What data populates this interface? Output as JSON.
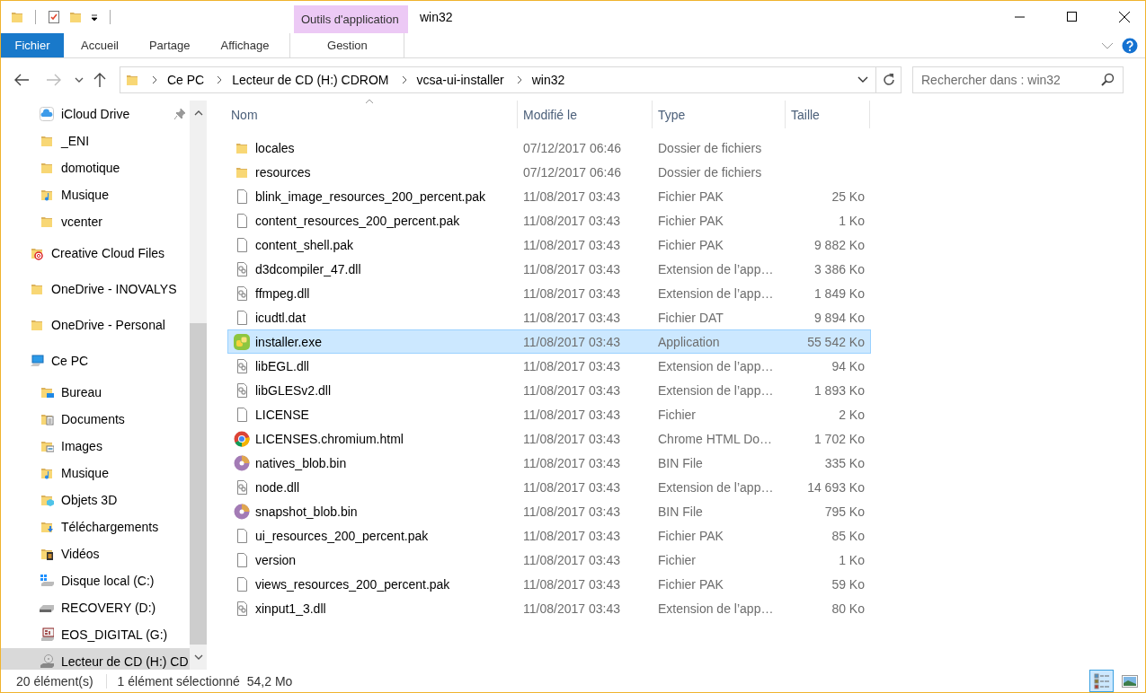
{
  "window": {
    "title": "win32",
    "context_tab_group": "Outils d'application"
  },
  "ribbon_tabs": [
    {
      "label": "Fichier",
      "kind": "file",
      "selected": false,
      "contextual": false
    },
    {
      "label": "Accueil",
      "kind": "tab",
      "selected": false,
      "contextual": false
    },
    {
      "label": "Partage",
      "kind": "tab",
      "selected": false,
      "contextual": false
    },
    {
      "label": "Affichage",
      "kind": "tab",
      "selected": false,
      "contextual": false
    },
    {
      "label": "Gestion",
      "kind": "tab",
      "selected": false,
      "contextual": true
    }
  ],
  "address_bar": {
    "breadcrumbs": [
      "Ce PC",
      "Lecteur de CD (H:) CDROM",
      "vcsa-ui-installer",
      "win32"
    ]
  },
  "search": {
    "placeholder": "Rechercher dans : win32"
  },
  "sidebar": {
    "quick_access": [
      {
        "label": "iCloud Drive",
        "kind": "icloud",
        "pinned": true,
        "selected": false
      },
      {
        "label": "_ENI",
        "kind": "folder",
        "pinned": false,
        "selected": false
      },
      {
        "label": "domotique",
        "kind": "folder",
        "pinned": false,
        "selected": false
      },
      {
        "label": "Musique",
        "kind": "music",
        "pinned": false,
        "selected": false
      },
      {
        "label": "vcenter",
        "kind": "folder",
        "pinned": false,
        "selected": false
      }
    ],
    "places": [
      {
        "label": "Creative Cloud Files",
        "kind": "cc",
        "selected": false
      },
      {
        "label": "OneDrive - INOVALYS",
        "kind": "folder",
        "selected": false
      },
      {
        "label": "OneDrive - Personal",
        "kind": "folder",
        "selected": false
      },
      {
        "label": "Ce PC",
        "kind": "pc",
        "selected": false,
        "children": [
          {
            "label": "Bureau",
            "kind": "desktop",
            "selected": false
          },
          {
            "label": "Documents",
            "kind": "documents",
            "selected": false
          },
          {
            "label": "Images",
            "kind": "images",
            "selected": false
          },
          {
            "label": "Musique",
            "kind": "music",
            "selected": false
          },
          {
            "label": "Objets 3D",
            "kind": "objects3d",
            "selected": false
          },
          {
            "label": "Téléchargements",
            "kind": "downloads",
            "selected": false
          },
          {
            "label": "Vidéos",
            "kind": "videos",
            "selected": false
          },
          {
            "label": "Disque local (C:)",
            "kind": "windisk",
            "selected": false
          },
          {
            "label": "RECOVERY (D:)",
            "kind": "disk",
            "selected": false
          },
          {
            "label": "EOS_DIGITAL (G:)",
            "kind": "sd",
            "selected": false
          },
          {
            "label": "Lecteur de CD (H:) CD",
            "kind": "cd",
            "selected": true
          }
        ]
      }
    ]
  },
  "table": {
    "columns": [
      "Nom",
      "Modifié le",
      "Type",
      "Taille"
    ],
    "rows": [
      {
        "name": "locales",
        "kind": "folder",
        "modified": "07/12/2017 06:46",
        "type": "Dossier de fichiers",
        "selected": false
      },
      {
        "name": "resources",
        "kind": "folder",
        "modified": "07/12/2017 06:46",
        "type": "Dossier de fichiers",
        "selected": false
      },
      {
        "name": "blink_image_resources_200_percent.pak",
        "kind": "file",
        "modified": "11/08/2017 03:43",
        "type": "Fichier PAK",
        "size": "25 Ko",
        "selected": false
      },
      {
        "name": "content_resources_200_percent.pak",
        "kind": "file",
        "modified": "11/08/2017 03:43",
        "type": "Fichier PAK",
        "size": "1 Ko",
        "selected": false
      },
      {
        "name": "content_shell.pak",
        "kind": "file",
        "modified": "11/08/2017 03:43",
        "type": "Fichier PAK",
        "size": "9 882 Ko",
        "selected": false
      },
      {
        "name": "d3dcompiler_47.dll",
        "kind": "dll",
        "modified": "11/08/2017 03:43",
        "type": "Extension de l’app…",
        "size": "3 386 Ko",
        "selected": false
      },
      {
        "name": "ffmpeg.dll",
        "kind": "dll",
        "modified": "11/08/2017 03:43",
        "type": "Extension de l’app…",
        "size": "1 849 Ko",
        "selected": false
      },
      {
        "name": "icudtl.dat",
        "kind": "file",
        "modified": "11/08/2017 03:43",
        "type": "Fichier DAT",
        "size": "9 894 Ko",
        "selected": false
      },
      {
        "name": "installer.exe",
        "kind": "exe",
        "modified": "11/08/2017 03:43",
        "type": "Application",
        "size": "55 542 Ko",
        "selected": true
      },
      {
        "name": "libEGL.dll",
        "kind": "dll",
        "modified": "11/08/2017 03:43",
        "type": "Extension de l’app…",
        "size": "94 Ko",
        "selected": false
      },
      {
        "name": "libGLESv2.dll",
        "kind": "dll",
        "modified": "11/08/2017 03:43",
        "type": "Extension de l’app…",
        "size": "1 893 Ko",
        "selected": false
      },
      {
        "name": "LICENSE",
        "kind": "file",
        "modified": "11/08/2017 03:43",
        "type": "Fichier",
        "size": "2 Ko",
        "selected": false
      },
      {
        "name": "LICENSES.chromium.html",
        "kind": "chrome",
        "modified": "11/08/2017 03:43",
        "type": "Chrome HTML Do…",
        "size": "1 702 Ko",
        "selected": false
      },
      {
        "name": "natives_blob.bin",
        "kind": "bin",
        "modified": "11/08/2017 03:43",
        "type": "BIN File",
        "size": "335 Ko",
        "selected": false
      },
      {
        "name": "node.dll",
        "kind": "dll",
        "modified": "11/08/2017 03:43",
        "type": "Extension de l’app…",
        "size": "14 693 Ko",
        "selected": false
      },
      {
        "name": "snapshot_blob.bin",
        "kind": "bin",
        "modified": "11/08/2017 03:43",
        "type": "BIN File",
        "size": "795 Ko",
        "selected": false
      },
      {
        "name": "ui_resources_200_percent.pak",
        "kind": "file",
        "modified": "11/08/2017 03:43",
        "type": "Fichier PAK",
        "size": "85 Ko",
        "selected": false
      },
      {
        "name": "version",
        "kind": "file",
        "modified": "11/08/2017 03:43",
        "type": "Fichier",
        "size": "1 Ko",
        "selected": false
      },
      {
        "name": "views_resources_200_percent.pak",
        "kind": "file",
        "modified": "11/08/2017 03:43",
        "type": "Fichier PAK",
        "size": "59 Ko",
        "selected": false
      },
      {
        "name": "xinput1_3.dll",
        "kind": "dll",
        "modified": "11/08/2017 03:43",
        "type": "Extension de l’app…",
        "size": "80 Ko",
        "selected": false
      }
    ]
  },
  "status_bar": {
    "item_count": "20 élément(s)",
    "selection": "1 élément sélectionné",
    "selection_size": "54,2 Mo",
    "views": [
      {
        "kind": "details",
        "selected": true
      },
      {
        "kind": "large-icons",
        "selected": false
      }
    ]
  }
}
